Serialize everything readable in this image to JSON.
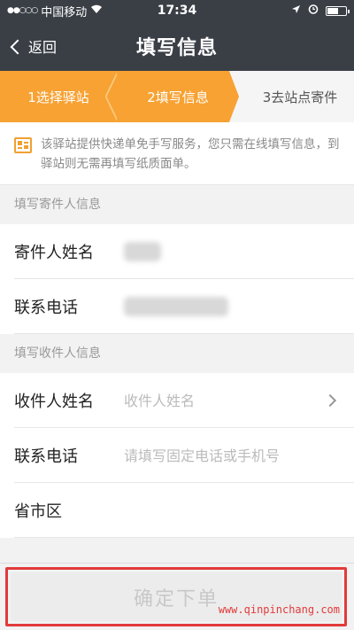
{
  "status_bar": {
    "signal": "●●○○○",
    "carrier": "中国移动",
    "wifi_icon": "wifi-icon",
    "time": "17:34",
    "location_icon": "location-arrow-icon",
    "alarm_icon": "alarm-clock-icon",
    "battery_level": 0.65
  },
  "nav": {
    "back_label": "返回",
    "title": "填写信息"
  },
  "steps": [
    {
      "label": "1选择驿站",
      "state": "done"
    },
    {
      "label": "2填写信息",
      "state": "current"
    },
    {
      "label": "3去站点寄件",
      "state": "pending"
    }
  ],
  "notice": {
    "icon": "form-icon",
    "text": "该驿站提供快递单免手写服务，您只需在线填写信息，到驿站则无需再填写纸质面单。"
  },
  "sender": {
    "section_title": "填写寄件人信息",
    "name_label": "寄件人姓名",
    "phone_label": "联系电话"
  },
  "receiver": {
    "section_title": "填写收件人信息",
    "name_label": "收件人姓名",
    "name_placeholder": "收件人姓名",
    "phone_label": "联系电话",
    "phone_placeholder": "请填写固定电话或手机号",
    "region_label": "省市区"
  },
  "submit_label": "确定下单",
  "watermark": "www.qinpinchang.com",
  "colors": {
    "nav_bg": "#3a3f46",
    "step_active": "#f7a233",
    "highlight_border": "#e23a3a"
  }
}
